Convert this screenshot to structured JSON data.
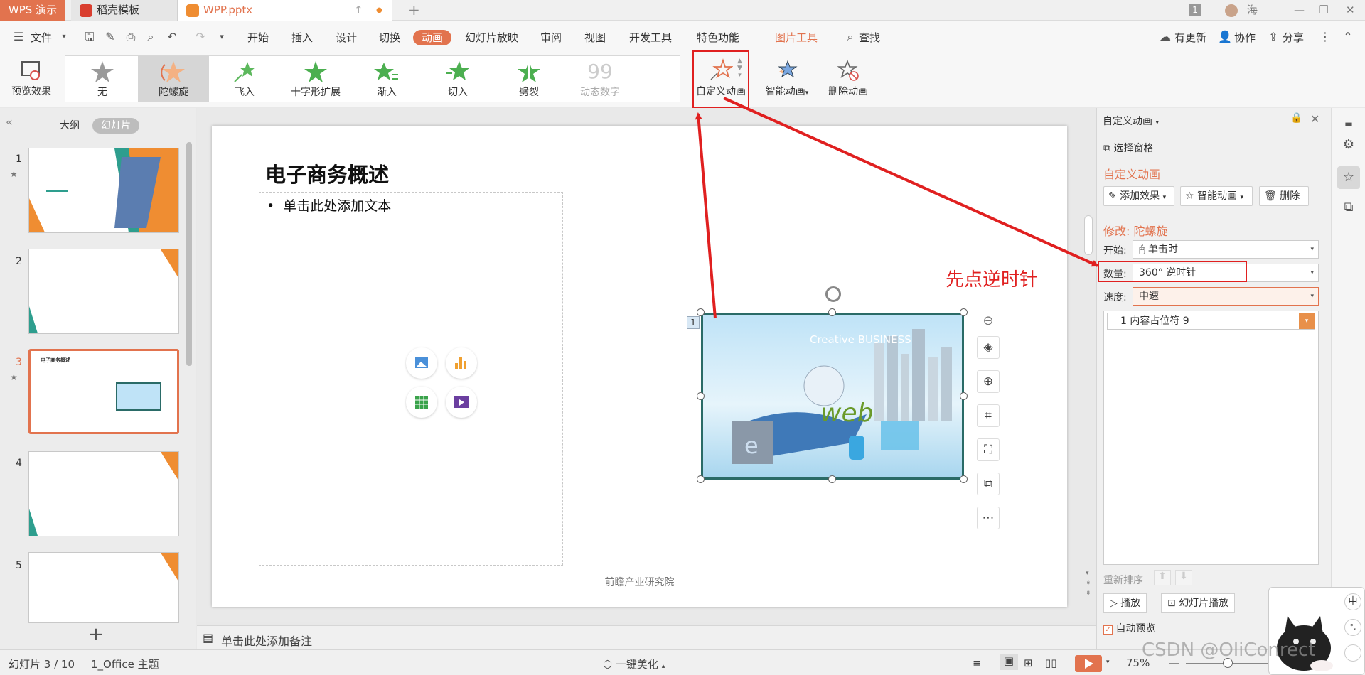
{
  "titlebar": {
    "app_tab": "WPS 演示",
    "tabs": [
      {
        "label": "稻壳模板"
      },
      {
        "label": "WPP.pptx"
      }
    ],
    "new_tab": "+",
    "badge": "1",
    "user_name": "海"
  },
  "menubar": {
    "file": "文件",
    "items": [
      "开始",
      "插入",
      "设计",
      "切换",
      "动画",
      "幻灯片放映",
      "审阅",
      "视图",
      "开发工具",
      "特色功能"
    ],
    "active": "动画",
    "picture_tools": "图片工具",
    "search": "查找",
    "right": {
      "update": "有更新",
      "collab": "协作",
      "share": "分享"
    }
  },
  "ribbon": {
    "preview": "预览效果",
    "gallery": [
      "无",
      "陀螺旋",
      "飞入",
      "十字形扩展",
      "渐入",
      "切入",
      "劈裂",
      "动态数字"
    ],
    "selected": "陀螺旋",
    "custom_anim": "自定义动画",
    "smart_anim": "智能动画",
    "delete_anim": "删除动画"
  },
  "leftpanel": {
    "tab_outline": "大纲",
    "tab_slides": "幻灯片",
    "slide_numbers": [
      "1",
      "2",
      "3",
      "4",
      "5"
    ],
    "selected_slide": "3",
    "thumb3_title": "电子商务概述",
    "add": "+"
  },
  "slide": {
    "title": "电子商务概述",
    "content_placeholder": "单击此处添加文本",
    "footer": "前瞻产业研究院",
    "image_badge": "1",
    "image_text_brand": "Creative BUSINESS",
    "image_text_web": "web",
    "image_text_e": "e"
  },
  "annotation": {
    "text": "先点逆时针",
    "color": "#e02020"
  },
  "notes": {
    "placeholder": "单击此处添加备注"
  },
  "rightpanel": {
    "title": "自定义动画",
    "select_pane": "选择窗格",
    "section": "自定义动画",
    "add_effect": "添加效果",
    "smart_anim": "智能动画",
    "delete": "删除",
    "modify": "修改: 陀螺旋",
    "start_label": "开始:",
    "start_value": "单击时",
    "qty_label": "数量:",
    "qty_value": "360° 逆时针",
    "speed_label": "速度:",
    "speed_value": "中速",
    "list_item": "1   内容占位符 9",
    "reorder": "重新排序",
    "play": "播放",
    "slideshow": "幻灯片播放",
    "auto_preview": "自动预览"
  },
  "statusbar": {
    "slide_pos": "幻灯片 3 / 10",
    "theme": "1_Office 主题",
    "beautify": "一键美化",
    "zoom": "75%"
  },
  "watermark": "CSDN @OliConrect",
  "ime": {
    "mode": "中",
    "punct": "°,"
  },
  "colors": {
    "accent": "#e2734e",
    "annotation_red": "#e02020"
  }
}
